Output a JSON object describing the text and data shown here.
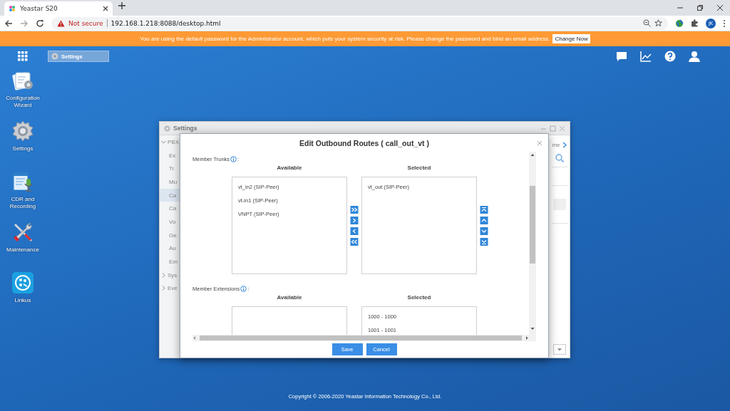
{
  "browser": {
    "tab_title": "Yeastar S20",
    "security": "Not secure",
    "url": "192.168.1.218:8088/desktop.html",
    "profile": "JK"
  },
  "banner": {
    "message": "You are using the default password for the Administrator account, which puts your system security at risk. Please change the password and bind an email address.",
    "button": "Change Now"
  },
  "taskbar": {
    "items": [
      {
        "label": "Settings",
        "selected": true
      }
    ]
  },
  "desktop_icons": [
    {
      "label": "Configuration Wizard",
      "kind": "wizard"
    },
    {
      "label": "Settings",
      "kind": "gear"
    },
    {
      "label": "CDR and Recording",
      "kind": "cdr"
    },
    {
      "label": "Maintenance",
      "kind": "tools"
    },
    {
      "label": "Linkus",
      "kind": "linkus"
    }
  ],
  "settings_window": {
    "title": "Settings",
    "nav": [
      {
        "label": "PBX",
        "expanded": true,
        "selected": false,
        "children": [
          {
            "label": "Ex",
            "selected": false
          },
          {
            "label": "Tr",
            "selected": false
          },
          {
            "label": "Mu",
            "selected": false
          },
          {
            "label": "Ca",
            "selected": true
          },
          {
            "label": "Ca",
            "selected": false
          },
          {
            "label": "Vo",
            "selected": false
          },
          {
            "label": "Ge",
            "selected": false
          },
          {
            "label": "Au",
            "selected": false
          },
          {
            "label": "Em",
            "selected": false
          }
        ]
      },
      {
        "label": "Sys",
        "expanded": false,
        "selected": false
      },
      {
        "label": "Eve",
        "expanded": false,
        "selected": false
      }
    ],
    "tab_fragment": "me"
  },
  "dialog": {
    "title": "Edit Outbound Routes ( call_out_vt )",
    "sections": [
      {
        "label": "Member Trunks",
        "suffix": ":",
        "available_heading": "Available",
        "selected_heading": "Selected",
        "available": [
          "vt_in2 (SIP-Peer)",
          "vt-in1 (SIP-Peer)",
          "VNPT (SIP-Peer)"
        ],
        "selected": [
          "vt_out (SIP-Peer)"
        ],
        "controls": true
      },
      {
        "label": "Member Extensions",
        "suffix": ":",
        "available_heading": "Available",
        "selected_heading": "Selected",
        "selected": [
          "1000 - 1000",
          "1001 - 1001"
        ],
        "controls": false
      }
    ],
    "buttons": [
      "Save",
      "Cancel"
    ]
  },
  "footer": "Copyright © 2006-2020 Yeastar Information Technology Co., Ltd."
}
